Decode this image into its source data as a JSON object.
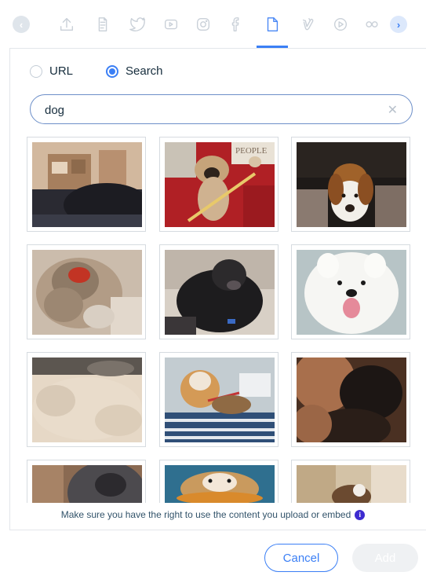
{
  "toolbar": {
    "icons": [
      "upload-icon",
      "giphy-icon",
      "twitter-icon",
      "youtube-icon",
      "instagram-icon",
      "facebook-icon",
      "document-icon",
      "vimeo-icon",
      "play-icon",
      "flickr-icon"
    ],
    "prev_label": "‹",
    "next_label": "›",
    "active": "document-icon"
  },
  "source": {
    "options": [
      {
        "label": "URL",
        "checked": false
      },
      {
        "label": "Search",
        "checked": true
      }
    ]
  },
  "search": {
    "value": "dog",
    "clear_label": "✕"
  },
  "results": {
    "items": [
      {
        "alt": "dog-gif-1"
      },
      {
        "alt": "dog-gif-2"
      },
      {
        "alt": "dog-gif-3"
      },
      {
        "alt": "dog-gif-4"
      },
      {
        "alt": "dog-gif-5"
      },
      {
        "alt": "dog-gif-6"
      },
      {
        "alt": "dog-gif-7"
      },
      {
        "alt": "dog-gif-8"
      },
      {
        "alt": "dog-gif-9"
      },
      {
        "alt": "dog-gif-10"
      },
      {
        "alt": "dog-gif-11"
      },
      {
        "alt": "dog-gif-12"
      }
    ]
  },
  "notice": {
    "text": "Make sure you have the right to use the content you upload or embed",
    "icon_label": "i"
  },
  "footer": {
    "cancel_label": "Cancel",
    "add_label": "Add"
  },
  "colors": {
    "accent": "#3b7ff5",
    "icon_inactive": "#c9d0d8",
    "text": "#162d3d",
    "info": "#3d2bd0"
  }
}
